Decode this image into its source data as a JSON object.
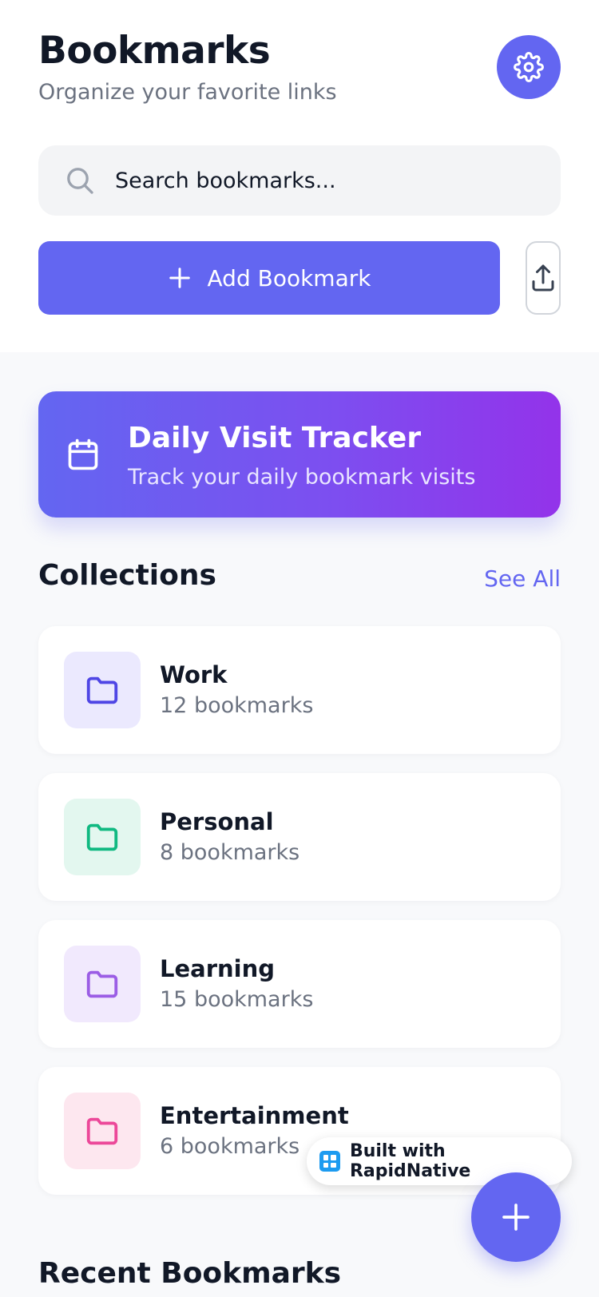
{
  "header": {
    "title": "Bookmarks",
    "subtitle": "Organize your favorite links",
    "settings_icon": "gear-icon"
  },
  "search": {
    "placeholder": "Search bookmarks..."
  },
  "actions": {
    "add_label": "Add Bookmark",
    "upload_icon": "upload-icon"
  },
  "tracker": {
    "title": "Daily Visit Tracker",
    "subtitle": "Track your daily bookmark visits",
    "icon": "calendar-icon"
  },
  "collections": {
    "title": "Collections",
    "see_all": "See All",
    "items": [
      {
        "name": "Work",
        "count": "12 bookmarks",
        "color": "#4f46e5",
        "bg": "#ebe9fe"
      },
      {
        "name": "Personal",
        "count": "8 bookmarks",
        "color": "#10b981",
        "bg": "#e3f7ef"
      },
      {
        "name": "Learning",
        "count": "15 bookmarks",
        "color": "#9b5de5",
        "bg": "#f1e9fd"
      },
      {
        "name": "Entertainment",
        "count": "6 bookmarks",
        "color": "#ec4899",
        "bg": "#fde7ef"
      }
    ]
  },
  "recent": {
    "title": "Recent Bookmarks"
  },
  "badge": {
    "label": "Built with RapidNative"
  },
  "colors": {
    "accent": "#6366f1",
    "gradient_end": "#9333ea"
  }
}
